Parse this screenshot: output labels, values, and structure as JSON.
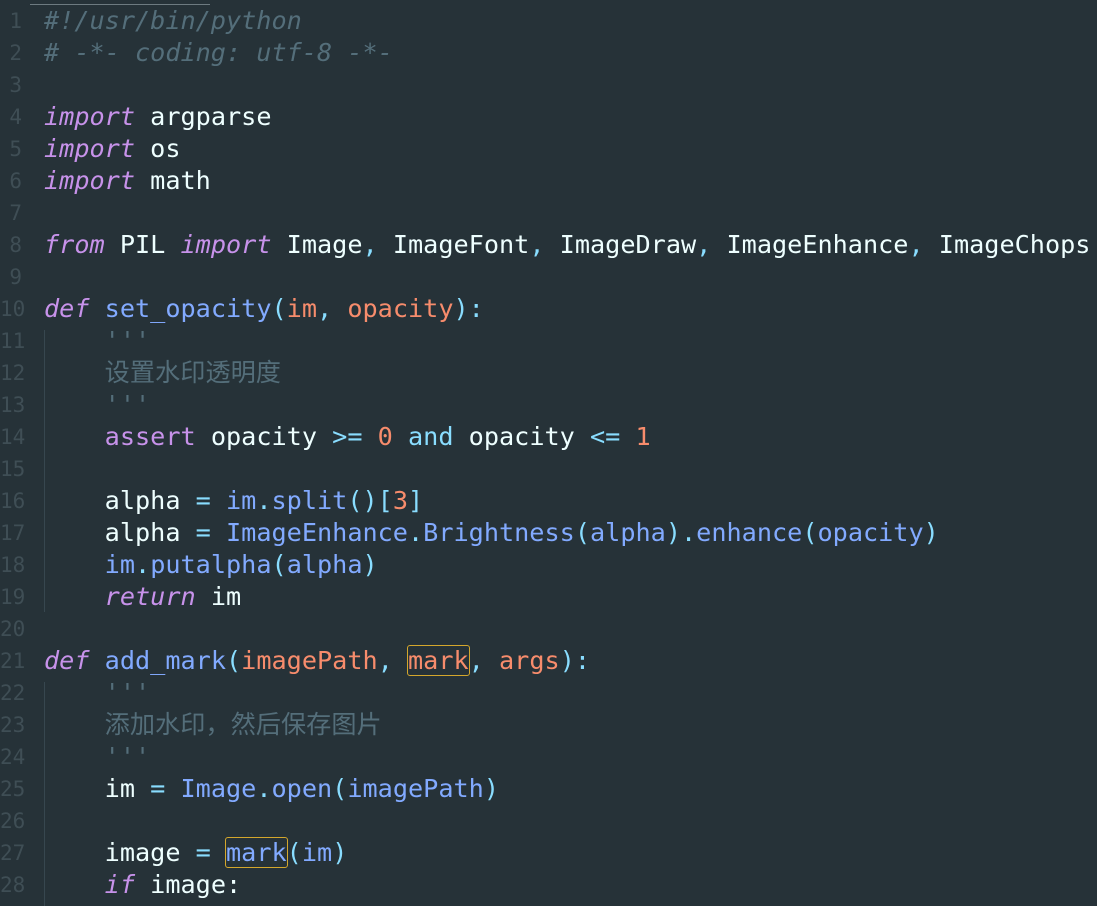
{
  "editor": {
    "theme_colors": {
      "background": "#263238",
      "keyword": "#c792ea",
      "function": "#82aaff",
      "parameter": "#f78c6c",
      "punctuation": "#89ddff",
      "comment": "#546e7a",
      "text": "#eeffff",
      "highlight_border": "#d4a72c"
    },
    "lines": [
      {
        "n": "1",
        "tokens": [
          {
            "t": "#!/usr/bin/python",
            "c": "cmt"
          }
        ]
      },
      {
        "n": "2",
        "tokens": [
          {
            "t": "# -*- coding: utf-8 -*-",
            "c": "cmt"
          }
        ]
      },
      {
        "n": "3",
        "tokens": []
      },
      {
        "n": "4",
        "tokens": [
          {
            "t": "import",
            "c": "kw-i"
          },
          {
            "t": " argparse",
            "c": ""
          }
        ]
      },
      {
        "n": "5",
        "tokens": [
          {
            "t": "import",
            "c": "kw-i"
          },
          {
            "t": " os",
            "c": ""
          }
        ]
      },
      {
        "n": "6",
        "tokens": [
          {
            "t": "import",
            "c": "kw-i"
          },
          {
            "t": " math",
            "c": ""
          }
        ]
      },
      {
        "n": "7",
        "tokens": []
      },
      {
        "n": "8",
        "tokens": [
          {
            "t": "from",
            "c": "kw-i"
          },
          {
            "t": " PIL ",
            "c": ""
          },
          {
            "t": "import",
            "c": "kw-i"
          },
          {
            "t": " Image",
            "c": ""
          },
          {
            "t": ",",
            "c": "punc"
          },
          {
            "t": " ImageFont",
            "c": ""
          },
          {
            "t": ",",
            "c": "punc"
          },
          {
            "t": " ImageDraw",
            "c": ""
          },
          {
            "t": ",",
            "c": "punc"
          },
          {
            "t": " ImageEnhance",
            "c": ""
          },
          {
            "t": ",",
            "c": "punc"
          },
          {
            "t": " ImageChops",
            "c": ""
          }
        ]
      },
      {
        "n": "9",
        "tokens": []
      },
      {
        "n": "10",
        "tokens": [
          {
            "t": "def",
            "c": "kw-i"
          },
          {
            "t": " ",
            "c": ""
          },
          {
            "t": "set_opacity",
            "c": "fn"
          },
          {
            "t": "(",
            "c": "punc"
          },
          {
            "t": "im",
            "c": "param"
          },
          {
            "t": ", ",
            "c": "punc"
          },
          {
            "t": "opacity",
            "c": "param"
          },
          {
            "t": "):",
            "c": "punc"
          }
        ]
      },
      {
        "n": "11",
        "tokens": [
          {
            "t": "    '''",
            "c": "str"
          }
        ]
      },
      {
        "n": "12",
        "tokens": [
          {
            "t": "    设置水印透明度",
            "c": "str"
          }
        ]
      },
      {
        "n": "13",
        "tokens": [
          {
            "t": "    '''",
            "c": "str"
          }
        ]
      },
      {
        "n": "14",
        "tokens": [
          {
            "t": "    ",
            "c": ""
          },
          {
            "t": "assert",
            "c": "kw"
          },
          {
            "t": " opacity ",
            "c": ""
          },
          {
            "t": ">=",
            "c": "op"
          },
          {
            "t": " ",
            "c": ""
          },
          {
            "t": "0",
            "c": "num"
          },
          {
            "t": " ",
            "c": ""
          },
          {
            "t": "and",
            "c": "op"
          },
          {
            "t": " opacity ",
            "c": ""
          },
          {
            "t": "<=",
            "c": "op"
          },
          {
            "t": " ",
            "c": ""
          },
          {
            "t": "1",
            "c": "num"
          }
        ]
      },
      {
        "n": "15",
        "tokens": []
      },
      {
        "n": "16",
        "tokens": [
          {
            "t": "    alpha ",
            "c": ""
          },
          {
            "t": "=",
            "c": "op"
          },
          {
            "t": " ",
            "c": ""
          },
          {
            "t": "im",
            "c": "fn"
          },
          {
            "t": ".",
            "c": "punc"
          },
          {
            "t": "split",
            "c": "fn"
          },
          {
            "t": "()[",
            "c": "punc"
          },
          {
            "t": "3",
            "c": "num"
          },
          {
            "t": "]",
            "c": "punc"
          }
        ]
      },
      {
        "n": "17",
        "tokens": [
          {
            "t": "    alpha ",
            "c": ""
          },
          {
            "t": "=",
            "c": "op"
          },
          {
            "t": " ",
            "c": ""
          },
          {
            "t": "ImageEnhance",
            "c": "cls"
          },
          {
            "t": ".",
            "c": "punc"
          },
          {
            "t": "Brightness",
            "c": "fn"
          },
          {
            "t": "(",
            "c": "punc"
          },
          {
            "t": "alpha",
            "c": "fn"
          },
          {
            "t": ").",
            "c": "punc"
          },
          {
            "t": "enhance",
            "c": "fn"
          },
          {
            "t": "(",
            "c": "punc"
          },
          {
            "t": "opacity",
            "c": "fn"
          },
          {
            "t": ")",
            "c": "punc"
          }
        ]
      },
      {
        "n": "18",
        "tokens": [
          {
            "t": "    ",
            "c": ""
          },
          {
            "t": "im",
            "c": "fn"
          },
          {
            "t": ".",
            "c": "punc"
          },
          {
            "t": "putalpha",
            "c": "fn"
          },
          {
            "t": "(",
            "c": "punc"
          },
          {
            "t": "alpha",
            "c": "fn"
          },
          {
            "t": ")",
            "c": "punc"
          }
        ]
      },
      {
        "n": "19",
        "tokens": [
          {
            "t": "    ",
            "c": ""
          },
          {
            "t": "return",
            "c": "kw-i"
          },
          {
            "t": " im",
            "c": ""
          }
        ]
      },
      {
        "n": "20",
        "tokens": []
      },
      {
        "n": "21",
        "tokens": [
          {
            "t": "def",
            "c": "kw-i"
          },
          {
            "t": " ",
            "c": ""
          },
          {
            "t": "add_mark",
            "c": "fn"
          },
          {
            "t": "(",
            "c": "punc"
          },
          {
            "t": "imagePath",
            "c": "param"
          },
          {
            "t": ", ",
            "c": "punc"
          },
          {
            "t": "mark",
            "c": "param",
            "hl": true
          },
          {
            "t": ", ",
            "c": "punc"
          },
          {
            "t": "args",
            "c": "param"
          },
          {
            "t": "):",
            "c": "punc"
          }
        ]
      },
      {
        "n": "22",
        "tokens": [
          {
            "t": "    '''",
            "c": "str"
          }
        ]
      },
      {
        "n": "23",
        "tokens": [
          {
            "t": "    添加水印，然后保存图片",
            "c": "str"
          }
        ]
      },
      {
        "n": "24",
        "tokens": [
          {
            "t": "    '''",
            "c": "str"
          }
        ]
      },
      {
        "n": "25",
        "tokens": [
          {
            "t": "    im ",
            "c": ""
          },
          {
            "t": "=",
            "c": "op"
          },
          {
            "t": " ",
            "c": ""
          },
          {
            "t": "Image",
            "c": "cls"
          },
          {
            "t": ".",
            "c": "punc"
          },
          {
            "t": "open",
            "c": "fn"
          },
          {
            "t": "(",
            "c": "punc"
          },
          {
            "t": "imagePath",
            "c": "fn"
          },
          {
            "t": ")",
            "c": "punc"
          }
        ]
      },
      {
        "n": "26",
        "tokens": []
      },
      {
        "n": "27",
        "tokens": [
          {
            "t": "    image ",
            "c": ""
          },
          {
            "t": "=",
            "c": "op"
          },
          {
            "t": " ",
            "c": ""
          },
          {
            "t": "mark",
            "c": "fn",
            "hl": true
          },
          {
            "t": "(",
            "c": "punc"
          },
          {
            "t": "im",
            "c": "fn"
          },
          {
            "t": ")",
            "c": "punc"
          }
        ]
      },
      {
        "n": "28",
        "tokens": [
          {
            "t": "    ",
            "c": ""
          },
          {
            "t": "if",
            "c": "kw-i"
          },
          {
            "t": " image:",
            "c": ""
          }
        ]
      }
    ]
  }
}
